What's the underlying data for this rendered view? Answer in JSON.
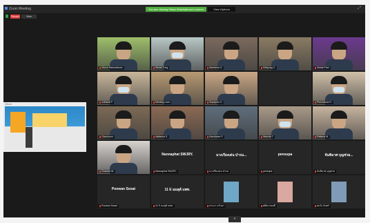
{
  "window": {
    "title": "Zoom Meeting"
  },
  "banner": {
    "text": "You are viewing Vitoon Ratchaiboon's screen",
    "options_label": "View Options"
  },
  "toolbar": {
    "record_label": "Record",
    "view_label": "View"
  },
  "share": {
    "label": "Vitoon"
  },
  "tiles": [
    {
      "label": "Vitoon Ratchaiboon",
      "type": "photo",
      "active": true,
      "color": "#9fbf6b"
    },
    {
      "label": "Wiwat Tung",
      "type": "photo",
      "color": "#b9c7c5"
    },
    {
      "label": "Nartnicha S.",
      "type": "photo",
      "color": "#7b6a5d"
    },
    {
      "label": "Kittipong C.",
      "type": "photo",
      "color": "#8a7b63"
    },
    {
      "label": "Sirilak Phet",
      "type": "photo",
      "color": "#6b3a8e"
    },
    {
      "label": "Jutharat P.",
      "type": "photo",
      "color": "#c9b79b"
    },
    {
      "label": "Meeting room",
      "type": "photo",
      "color": "#b89a73"
    },
    {
      "label": "Supaporn K.",
      "type": "photo",
      "color": "#caa785"
    },
    {
      "label": "",
      "type": "blank"
    },
    {
      "label": "Pimchanok R.",
      "type": "photo",
      "color": "#d0c0a8"
    },
    {
      "label": "Classroom",
      "type": "photo",
      "color": "#7d6a55"
    },
    {
      "label": "Nattawut S.",
      "type": "photo",
      "color": "#8b6a54"
    },
    {
      "label": "Kanokwan P.",
      "type": "photo",
      "color": "#5f6e7c"
    },
    {
      "label": "Wanida T.",
      "type": "photo",
      "color": "#a99a88"
    },
    {
      "label": "Rattana M.",
      "type": "photo",
      "color": "#c7b49f"
    },
    {
      "label": "Chanida W.",
      "type": "photo",
      "color": "#d7d3cf"
    },
    {
      "label": "Nannaphat SWJRY.",
      "type": "name",
      "name": "Nannaphat SWJRY."
    },
    {
      "label": "นางเรียงเด่น บำรม",
      "type": "name",
      "name": "นางเรียงเด่น บำรม..."
    },
    {
      "label": "pensupa",
      "type": "name",
      "name": "pensupa"
    },
    {
      "label": "จันทิมาศ บุญช่วย",
      "type": "name",
      "name": "จันทิมาศ บุญช่วย..."
    },
    {
      "label": "Poowan Sosat",
      "type": "name",
      "name": "Poowan Sosat"
    },
    {
      "label": "11 E มมลุด้ แพท.",
      "type": "name",
      "name": "11 E มมลุด้ แพท."
    },
    {
      "label": "ประภา แก้วตา",
      "type": "avatar",
      "color": "#6fa7c6"
    },
    {
      "label": "ศศิธร ทองดี",
      "type": "avatar",
      "color": "#d9a8a0"
    },
    {
      "label": "สมใจ จันทร์",
      "type": "avatar",
      "color": "#7f9bb8"
    }
  ],
  "pager": {
    "label": "▾"
  }
}
